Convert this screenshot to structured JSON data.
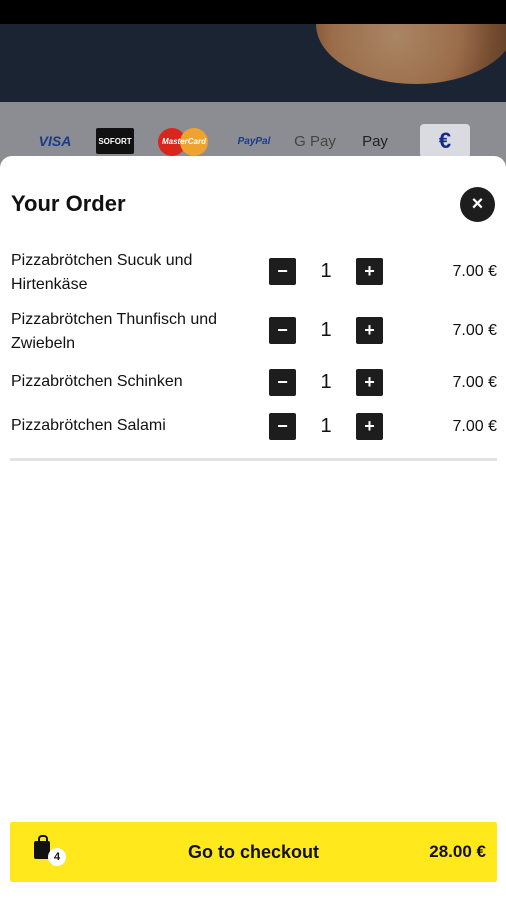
{
  "payment_methods": [
    {
      "name": "visa-logo",
      "label": "VISA"
    },
    {
      "name": "sofort-logo",
      "label": "SOFORT"
    },
    {
      "name": "mastercard-logo",
      "label": "MasterCard"
    },
    {
      "name": "paypal-logo",
      "label": "PayPal"
    },
    {
      "name": "google-pay-logo",
      "label": "G Pay"
    },
    {
      "name": "apple-pay-logo",
      "label": " Pay"
    },
    {
      "name": "cash-euro-logo",
      "label": "€"
    }
  ],
  "order": {
    "title": "Your Order",
    "close_icon": "×",
    "items": [
      {
        "name": "Pizzabrötchen Sucuk und Hirtenkäse",
        "quantity": 1,
        "price": "7.00 €"
      },
      {
        "name": "Pizzabrötchen Thunfisch und Zwiebeln",
        "quantity": 1,
        "price": "7.00 €"
      },
      {
        "name": "Pizzabrötchen Schinken",
        "quantity": 1,
        "price": "7.00 €"
      },
      {
        "name": "Pizzabrötchen Salami",
        "quantity": 1,
        "price": "7.00 €"
      }
    ],
    "minus_symbol": "−",
    "plus_symbol": "+"
  },
  "checkout": {
    "label": "Go to checkout",
    "total": "28.00 €",
    "cart_count": "4",
    "cart_icon": "shopping-bag-icon"
  },
  "colors": {
    "accent": "#ffe81c",
    "dark": "#1d1d1d",
    "euro": "#142a8a"
  }
}
